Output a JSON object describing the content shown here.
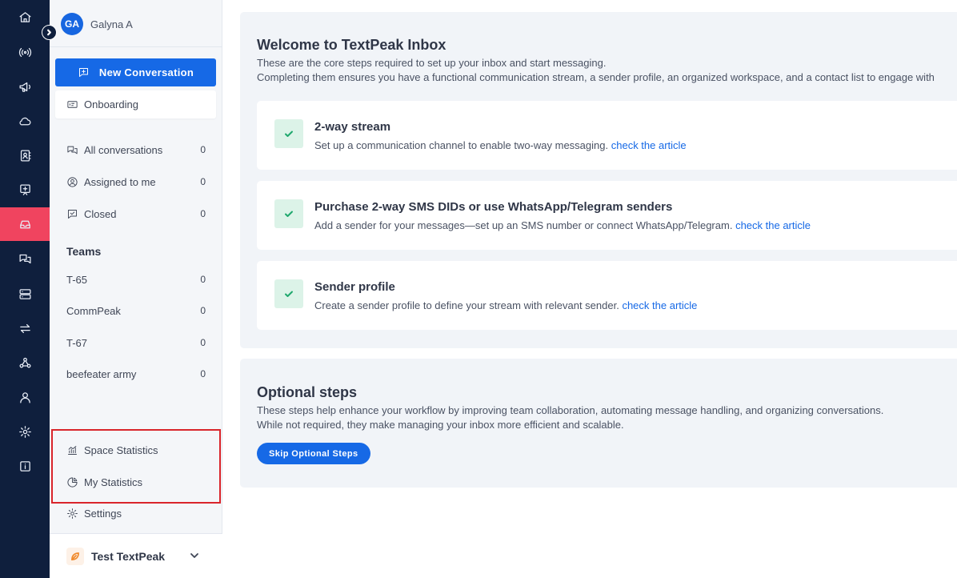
{
  "rail": {
    "items": [
      {
        "icon": "home-icon"
      },
      {
        "icon": "broadcast-icon"
      },
      {
        "icon": "megaphone-icon"
      },
      {
        "icon": "cloud-icon"
      },
      {
        "icon": "contacts-book-icon"
      },
      {
        "icon": "chat-screen-icon"
      },
      {
        "icon": "inbox-icon",
        "active": true
      },
      {
        "icon": "conversations-icon"
      },
      {
        "icon": "server-icon"
      },
      {
        "icon": "swap-arrows-icon"
      },
      {
        "icon": "webhook-icon"
      },
      {
        "icon": "user-icon"
      },
      {
        "icon": "settings-gear-icon"
      },
      {
        "icon": "info-icon"
      }
    ],
    "active_color": "#f0445f",
    "bg_color": "#0f1f3d"
  },
  "user": {
    "initials": "GA",
    "name": "Galyna A"
  },
  "sidebar": {
    "new_conversation_label": "New Conversation",
    "onboarding_label": "Onboarding",
    "nav": [
      {
        "label": "All conversations",
        "count": "0"
      },
      {
        "label": "Assigned to me",
        "count": "0"
      },
      {
        "label": "Closed",
        "count": "0"
      }
    ],
    "teams_title": "Teams",
    "teams": [
      {
        "label": "T-65",
        "count": "0"
      },
      {
        "label": "CommPeak",
        "count": "0"
      },
      {
        "label": "T-67",
        "count": "0"
      },
      {
        "label": "beefeater army",
        "count": "0"
      }
    ],
    "space_statistics_label": "Space Statistics",
    "my_statistics_label": "My Statistics",
    "settings_label": "Settings",
    "workspace_name": "Test TextPeak"
  },
  "welcome": {
    "title": "Welcome to TextPeak Inbox",
    "desc_line1": "These are the core steps required to set up your inbox and start messaging.",
    "desc_line2": "Completing them ensures you have a functional communication stream, a sender profile, an organized workspace, and a contact list to engage with",
    "steps": [
      {
        "title": "2-way stream",
        "desc": "Set up a communication channel to enable two-way messaging.",
        "link": "check the article",
        "done": true
      },
      {
        "title": "Purchase 2-way SMS DIDs or use WhatsApp/Telegram senders",
        "desc": "Add a sender for your messages—set up an SMS number or connect WhatsApp/Telegram.",
        "link": "check the article",
        "done": true
      },
      {
        "title": "Sender profile",
        "desc": "Create a sender profile to define your stream with relevant sender.",
        "link": "check the article",
        "done": true
      }
    ]
  },
  "optional": {
    "title": "Optional steps",
    "desc_line1": "These steps help enhance your workflow by improving team collaboration, automating message handling, and organizing conversations.",
    "desc_line2": "While not required, they make managing your inbox more efficient and scalable.",
    "skip_label": "Skip Optional Steps"
  },
  "colors": {
    "primary": "#1669e6",
    "success": "#1fa86d",
    "highlight": "#d9252b"
  }
}
